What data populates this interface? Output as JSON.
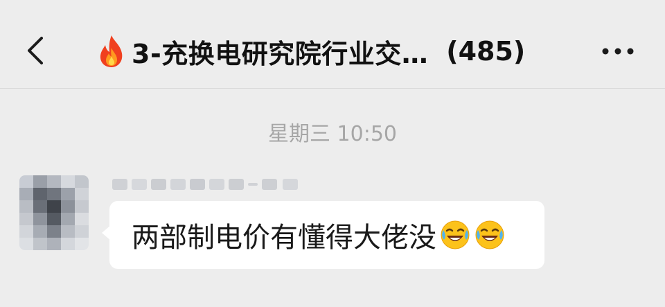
{
  "header": {
    "back_icon": "chevron-left-icon",
    "title_icon": "fire-icon",
    "title": "3-充换电研究院行业交…",
    "member_count": "(485)",
    "more_icon": "more-dots-icon"
  },
  "chat": {
    "timestamp": "星期三 10:50",
    "messages": [
      {
        "sender_name_obscured": true,
        "avatar_obscured": true,
        "text": "两部制电价有懂得大佬没",
        "emojis": [
          "laughing-crying-emoji-icon",
          "laughing-crying-emoji-icon"
        ]
      }
    ]
  },
  "colors": {
    "background": "#ededed",
    "bubble": "#ffffff",
    "text": "#111111",
    "timestamp": "#a6a6a6"
  }
}
